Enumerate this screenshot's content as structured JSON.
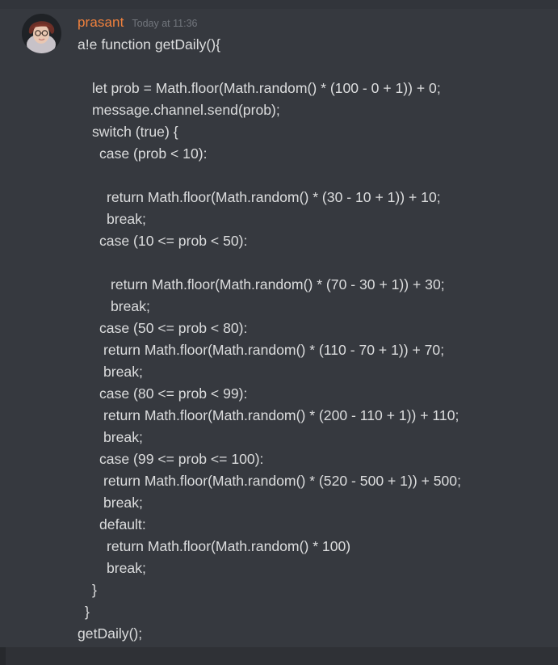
{
  "message": {
    "username": "prasant",
    "timestamp": "Today at 11:36",
    "username_color": "#f0813d",
    "lines": [
      "a!e function getDaily(){",
      "let prob = Math.floor(Math.random() * (100 - 0 + 1)) + 0;",
      "message.channel.send(prob);",
      "switch (true) {",
      "case (prob < 10):",
      "return Math.floor(Math.random() * (30 - 10 + 1)) + 10;",
      "break;",
      "case (10 <= prob < 50):",
      "return Math.floor(Math.random() * (70 - 30 + 1)) + 30;",
      "break;",
      "case (50 <= prob < 80):",
      "return Math.floor(Math.random() * (110 - 70 + 1)) + 70;",
      "break;",
      "case (80 <= prob < 99):",
      "return Math.floor(Math.random() * (200 - 110 + 1)) + 110;",
      "break;",
      "case (99 <= prob <= 100):",
      "return Math.floor(Math.random() * (520 - 500 + 1)) + 500;",
      "break;",
      "default:",
      "return Math.floor(Math.random() * 100)",
      "break;",
      "}",
      "}",
      "getDaily();"
    ]
  },
  "colors": {
    "background": "#36393f",
    "text": "#dcddde",
    "timestamp": "#72767d"
  }
}
